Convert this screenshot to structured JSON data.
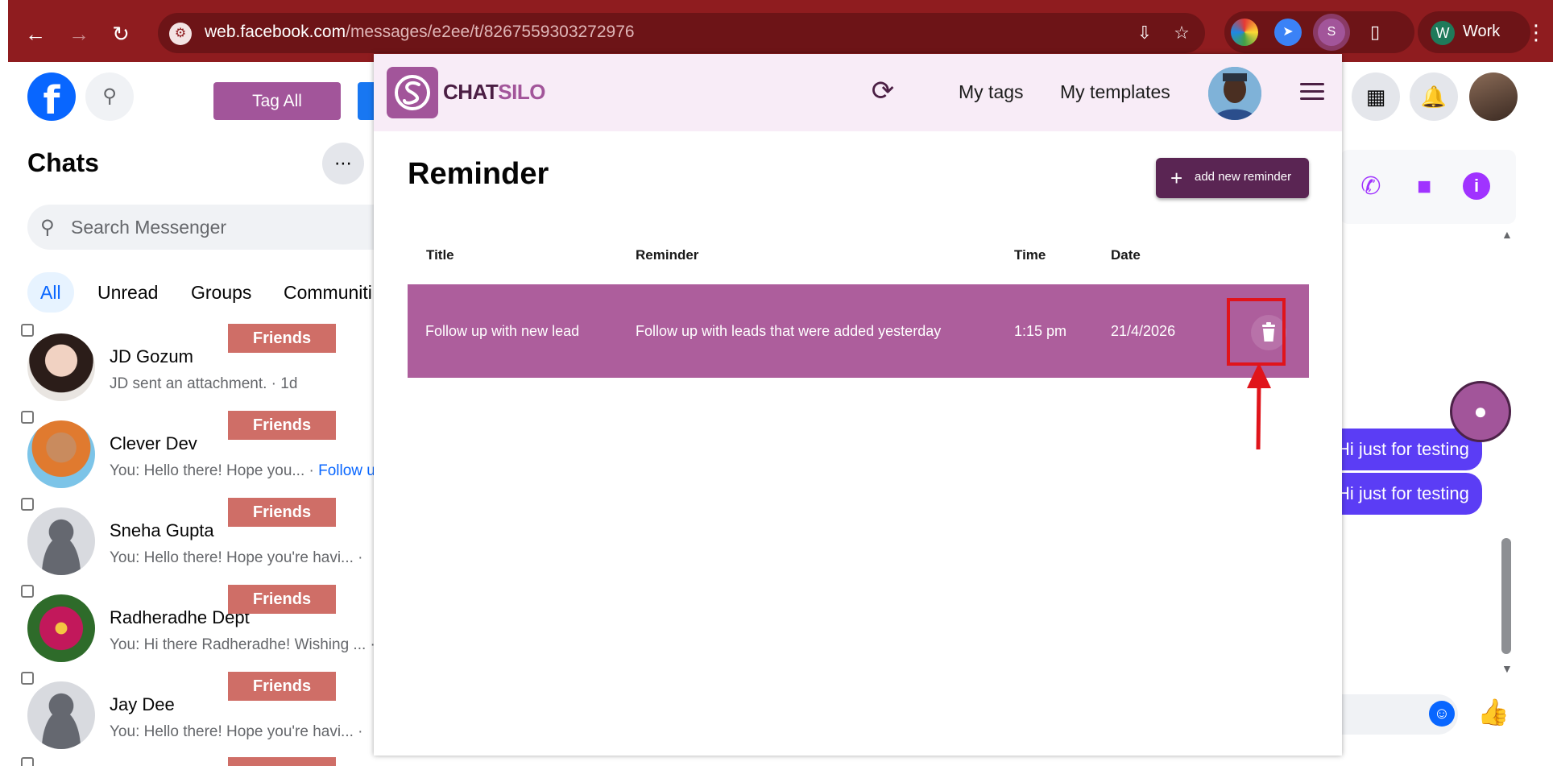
{
  "browser": {
    "url_host": "web.facebook.com",
    "url_path": "/messages/e2ee/t/8267559303272976",
    "profile_initial": "W",
    "profile_label": "Work"
  },
  "facebook": {
    "tag_all_label": "Tag All",
    "chats_title": "Chats",
    "search_placeholder": "Search Messenger",
    "filters": [
      "All",
      "Unread",
      "Groups",
      "Communiti"
    ],
    "friends_label": "Friends",
    "chats": [
      {
        "name": "JD Gozum",
        "preview": "JD sent an attachment. · 1d",
        "follow": ""
      },
      {
        "name": "Clever Dev",
        "preview": "You: Hello there! Hope you... · ",
        "follow": "Follow u"
      },
      {
        "name": "Sneha Gupta",
        "preview": "You: Hello there! Hope you're havi...  ·",
        "follow": ""
      },
      {
        "name": "Radheradhe Dept",
        "preview": "You: Hi there Radheradhe! Wishing ... ·",
        "follow": ""
      },
      {
        "name": "Jay Dee",
        "preview": "You: Hello there! Hope you're havi...  ·",
        "follow": ""
      }
    ],
    "messages": [
      "Hi just for testing",
      "Hi just for testing"
    ]
  },
  "chatsilo": {
    "brand_part1": "CHAT",
    "brand_part2": "SILO",
    "nav_tags": "My tags",
    "nav_templates": "My templates",
    "page_title": "Reminder",
    "add_button": "add new reminder",
    "columns": [
      "Title",
      "Reminder",
      "Time",
      "Date"
    ],
    "reminders": [
      {
        "title": "Follow up with new lead",
        "reminder": "Follow up with leads that were added yesterday",
        "time": "1:15 pm",
        "date": "21/4/2026"
      }
    ]
  },
  "colors": {
    "browser_bar": "#8f1c1f",
    "brand_purple": "#a2559a",
    "row_purple": "#ad5e9c",
    "button_dark": "#5a2553",
    "friends_badge": "#cf6e67",
    "highlight_red": "#e0141b"
  },
  "icons": [
    "back-arrow-icon",
    "forward-arrow-icon",
    "reload-icon",
    "site-info-icon",
    "install-icon",
    "star-icon",
    "extension-puzzle-icon",
    "refresh-icon",
    "hamburger-icon",
    "trash-icon",
    "plus-icon",
    "phone-icon",
    "video-icon",
    "info-icon",
    "emoji-icon",
    "like-icon"
  ]
}
